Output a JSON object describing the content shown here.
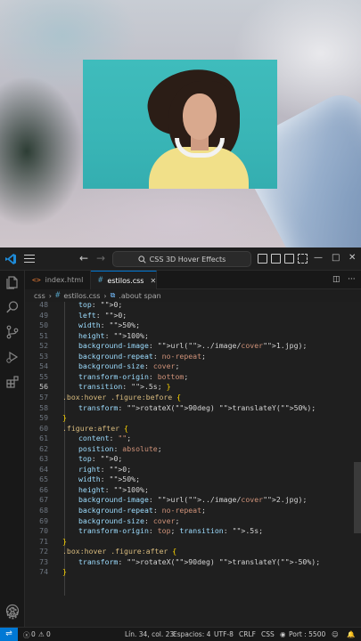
{
  "window": {
    "title": "CSS 3D Hover Effects"
  },
  "tabs": [
    {
      "label": "index.html",
      "icon": "html-icon"
    },
    {
      "label": "estilos.css",
      "icon": "css-icon"
    }
  ],
  "breadcrumb": {
    "folder": "css",
    "file": "estilos.css",
    "symbol": ".about span"
  },
  "code": {
    "lines": [
      {
        "n": "48",
        "text": "top: 0;"
      },
      {
        "n": "49",
        "text": "left: 0;"
      },
      {
        "n": "50",
        "text": "width: 50%;"
      },
      {
        "n": "51",
        "text": "height: 100%;"
      },
      {
        "n": "52",
        "text": "background-image: url(../image/cover1.jpg);"
      },
      {
        "n": "53",
        "text": "background-repeat: no-repeat;"
      },
      {
        "n": "54",
        "text": "background-size: cover;"
      },
      {
        "n": "55",
        "text": "transform-origin: bottom;"
      },
      {
        "n": "56",
        "text": "transition: .5s; }"
      },
      {
        "n": "57",
        "text": ".box:hover .figure:before {"
      },
      {
        "n": "58",
        "text": "transform: rotateX(90deg) translateY(50%);"
      },
      {
        "n": "59",
        "text": "}"
      },
      {
        "n": "60",
        "text": ".figure:after {"
      },
      {
        "n": "61",
        "text": "content: \"\";"
      },
      {
        "n": "62",
        "text": "position: absolute;"
      },
      {
        "n": "63",
        "text": "top: 0;"
      },
      {
        "n": "64",
        "text": "right: 0;"
      },
      {
        "n": "65",
        "text": "width: 50%;"
      },
      {
        "n": "66",
        "text": "height: 100%;"
      },
      {
        "n": "67",
        "text": "background-image: url(../image/cover2.jpg);"
      },
      {
        "n": "68",
        "text": "background-repeat: no-repeat;"
      },
      {
        "n": "69",
        "text": "background-size: cover;"
      },
      {
        "n": "70",
        "text": "transform-origin: top; transition: .5s;"
      },
      {
        "n": "71",
        "text": "}"
      },
      {
        "n": "72",
        "text": ".box:hover .figure:after {"
      },
      {
        "n": "73",
        "text": "transform: rotateX(90deg) translateY(-50%);"
      },
      {
        "n": "74",
        "text": "}"
      }
    ]
  },
  "statusbar": {
    "errors": "0",
    "warnings": "0",
    "position": "Lín. 34, col. 23",
    "spaces": "Espacios: 4",
    "encoding": "UTF-8",
    "eol": "CRLF",
    "language": "CSS",
    "port": "Port : 5500"
  },
  "colors": {
    "accent": "#0078d4",
    "editor_bg": "#1f1f1f",
    "selector": "#d7ba7d",
    "property": "#9cdcfe",
    "number": "#b5cea8",
    "string": "#ce9178"
  }
}
